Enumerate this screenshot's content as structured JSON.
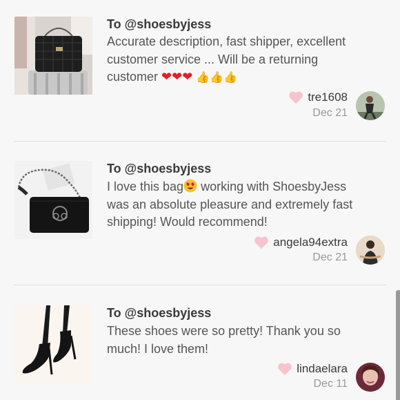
{
  "reviews": [
    {
      "to": "To @shoesbyjess",
      "text_lines": [
        "Accurate description, fast shipper, excellent",
        "customer service ... Will be a returning",
        "customer"
      ],
      "emojis": [
        "❤",
        "❤",
        "❤",
        "👍",
        "👍",
        "👍"
      ],
      "username": "tre1608",
      "date": "Dec 21"
    },
    {
      "to": "To @shoesbyjess",
      "text_lines": [
        "I love this bag",
        " working with ShoesbyJess",
        "was an absolute pleasure and extremely fast",
        "shipping! Would recommend!"
      ],
      "username": "angela94extra",
      "date": "Dec 21"
    },
    {
      "to": "To @shoesbyjess",
      "text_lines": [
        "These shoes were so pretty! Thank you so",
        "much! I love them!"
      ],
      "username": "lindaelara",
      "date": "Dec 11"
    }
  ],
  "colors": {
    "like_heart": "#f7c3cf",
    "divider": "#dedede",
    "emoji_heart": "#e0202a",
    "emoji_thumb": "#f2b31d"
  }
}
